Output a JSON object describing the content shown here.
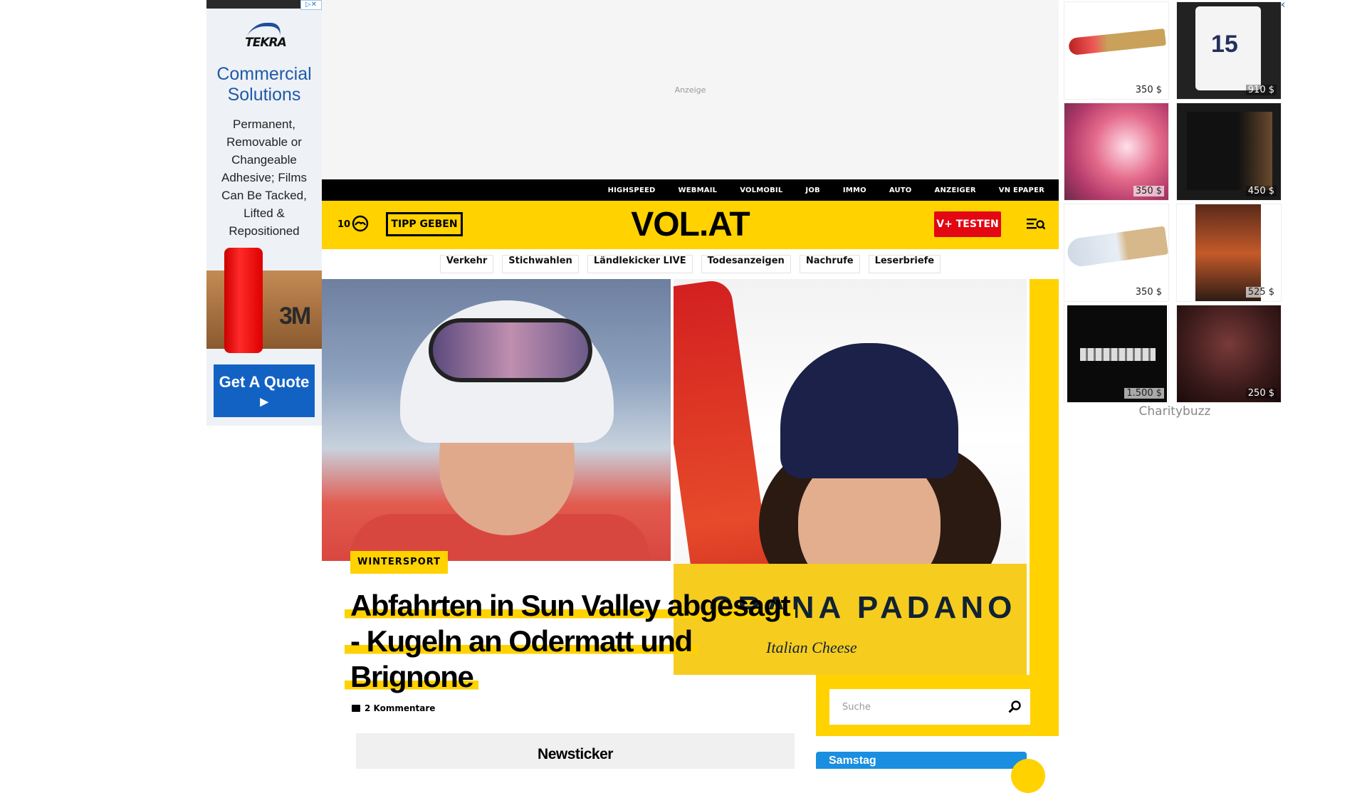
{
  "left_ad": {
    "adchoice": "▷✕",
    "brand": "TEKRA",
    "headline": "Commercial Solutions",
    "body": "Permanent, Removable or Changeable Adhesive; Films Can Be Tacked, Lifted & Repositioned",
    "product_label": "3M",
    "cta": "Get A Quote ▸"
  },
  "top_ad": {
    "label": "Anzeige"
  },
  "topnav": {
    "items": [
      "HIGHSPEED",
      "WEBMAIL",
      "VOLMOBIL",
      "JOB",
      "IMMO",
      "AUTO",
      "ANZEIGER",
      "VN EPAPER"
    ]
  },
  "header": {
    "weather_temp": "10",
    "tipp_label": "TIPP GEBEN",
    "logo": "VOL.AT",
    "vplus_label": "V+ TESTEN",
    "brand_color": "#ffd200"
  },
  "subnav": {
    "items": [
      "Verkehr",
      "Stichwahlen",
      "Ländlekicker LIVE",
      "Todesanzeigen",
      "Nachrufe",
      "Leserbriefe"
    ]
  },
  "article": {
    "category": "WINTERSPORT",
    "headline": "Abfahrten in Sun Valley abgesagt - Kugeln an Odermatt und Brignone",
    "comments": "2 Kommentare",
    "hero_right_text": "GRANA PADANO",
    "hero_right_sub": "Italian Cheese"
  },
  "search": {
    "placeholder": "Suche"
  },
  "newsticker": {
    "title": "Newsticker"
  },
  "weather_card": {
    "day": "Samstag"
  },
  "right_ad": {
    "adchoice": "▷ ✕",
    "tiles": [
      {
        "price": "350 $",
        "desc": "guitar"
      },
      {
        "price": "910 $",
        "desc": "framed jersey"
      },
      {
        "price": "350 $",
        "desc": "heart painting"
      },
      {
        "price": "450 $",
        "desc": "framed photo"
      },
      {
        "price": "350 $",
        "desc": "signed guitar"
      },
      {
        "price": "525 $",
        "desc": "poster"
      },
      {
        "price": "1.500 $",
        "desc": "bracelet"
      },
      {
        "price": "250 $",
        "desc": "concert photo"
      }
    ],
    "brand": "Charitybuzz"
  }
}
